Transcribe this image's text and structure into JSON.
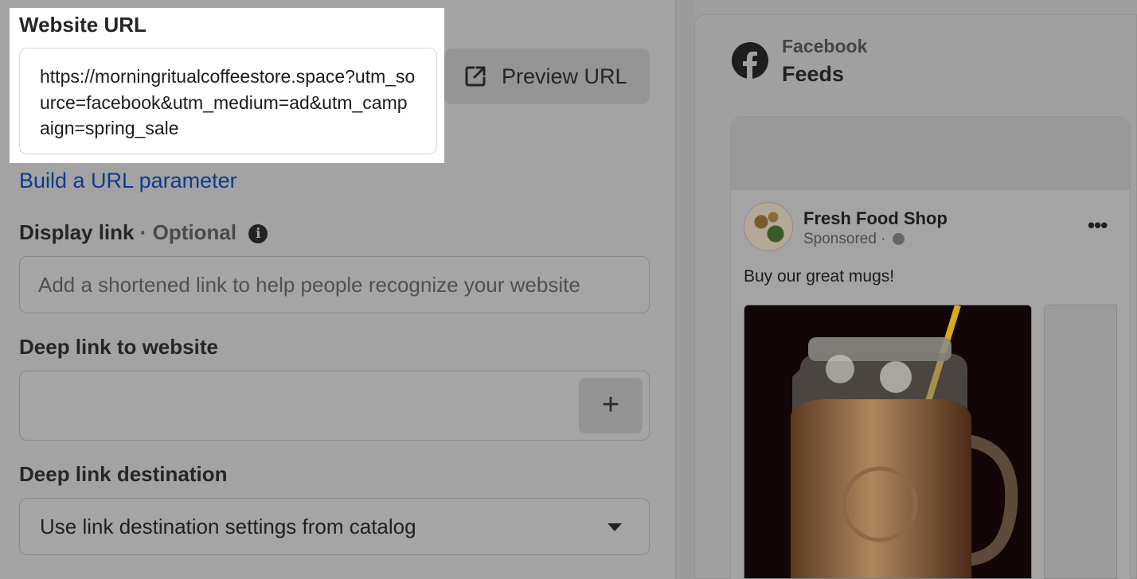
{
  "form": {
    "website_url_label": "Website URL",
    "website_url_value": "https://morningritualcoffeestore.space?utm_source=facebook&utm_medium=ad&utm_campaign=spring_sale",
    "preview_url_label": "Preview URL",
    "build_url_parameter_link": "Build a URL parameter",
    "display_link_label": "Display link",
    "display_link_optional": "· Optional",
    "display_link_placeholder": "Add a shortened link to help people recognize your website",
    "deep_link_label": "Deep link to website",
    "deep_link_value": "",
    "deep_link_add": "+",
    "deep_link_destination_label": "Deep link destination",
    "deep_link_destination_value": "Use link destination settings from catalog"
  },
  "preview": {
    "platform": "Facebook",
    "placement": "Feeds",
    "page_name": "Fresh Food Shop",
    "sponsored": "Sponsored ·",
    "more": "•••",
    "primary_text": "Buy our great mugs!"
  },
  "icons": {
    "external_link": "external-link-icon",
    "info": "info-icon",
    "plus": "plus-icon",
    "caret": "chevron-down-icon",
    "facebook": "facebook-logo-icon",
    "globe": "globe-icon",
    "more": "more-options-icon"
  },
  "colors": {
    "link": "#0b3c8e",
    "overlay_gray": "#a3a3a3",
    "spotlight": "#ffffff"
  }
}
